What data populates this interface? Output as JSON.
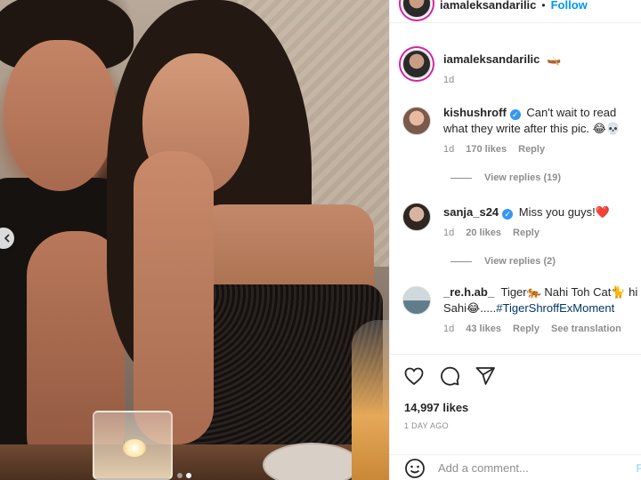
{
  "post": {
    "author": "iamaleksandarilic",
    "follow_label": "Follow",
    "separator": "•",
    "caption": "🛶",
    "caption_time": "1d",
    "photo_dots": 2,
    "active_dot": 1
  },
  "comments": [
    {
      "user": "kishushroff",
      "verified": true,
      "text": "Can't wait to read what they write after this pic. 😂💀",
      "time": "1d",
      "likes": "170 likes",
      "reply_label": "Reply",
      "view_replies": "View replies (19)"
    },
    {
      "user": "sanja_s24",
      "verified": true,
      "text": "Miss you guys!❤️",
      "time": "1d",
      "likes": "20 likes",
      "reply_label": "Reply",
      "view_replies": "View replies (2)"
    },
    {
      "user": "_re.h.ab_",
      "verified": false,
      "text": "Tiger🐅 Nahi Toh Cat🐈 hi Sahi😂.....",
      "hashtag": "#TigerShroffExMoment",
      "time": "1d",
      "likes": "43 likes",
      "reply_label": "Reply",
      "translate_label": "See translation"
    }
  ],
  "actions": {
    "like_icon": "heart-icon",
    "comment_icon": "comment-icon",
    "share_icon": "share-icon"
  },
  "likes_count": "14,997 likes",
  "posted_ago": "1 DAY AGO",
  "add_comment": {
    "placeholder": "Add a comment...",
    "post_label": "P",
    "emoji_icon": "emoji-icon"
  },
  "colors": {
    "accent": "#0095f6",
    "hashtag": "#00376b",
    "muted": "#8e8e8e"
  }
}
